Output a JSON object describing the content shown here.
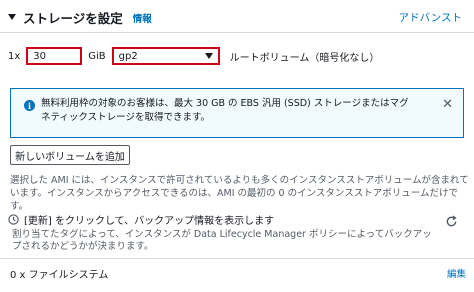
{
  "header": {
    "title": "ストレージを設定",
    "info_link": "情報",
    "advanced_link": "アドバンスト"
  },
  "volume": {
    "count_prefix": "1x",
    "size_value": "30",
    "unit": "GiB",
    "volume_type": "gp2",
    "root_label": "ルートボリューム（暗号化なし）"
  },
  "alert": {
    "text": "無料利用枠の対象のお客様は、最大 30 GB の EBS 汎用 (SSD) ストレージまたはマグネティックストレージを取得できます。",
    "icon": "info-icon",
    "close_icon": "close-icon"
  },
  "add_volume_button": "新しいボリュームを追加",
  "description": "選択した AMI には、インスタンスで許可されているよりも多くのインスタンスストアボリュームが含まれています。インスタンスからアクセスできるのは、AMI の最初の 0 のインスタンスストアボリュームだけです。",
  "refresh": {
    "main": "[更新] をクリックして、バックアップ情報を表示します",
    "sub": "割り当てたタグによって、インスタンスが Data Lifecycle Manager ポリシーによってバックアップされるかどうかが決まります。",
    "icon": "refresh-icon"
  },
  "file_systems": {
    "label": "0 x ファイルシステム",
    "edit_link": "編集"
  },
  "colors": {
    "link": "#0073bb",
    "highlight_border": "#d0021b",
    "alert_bg": "#f1faff"
  }
}
